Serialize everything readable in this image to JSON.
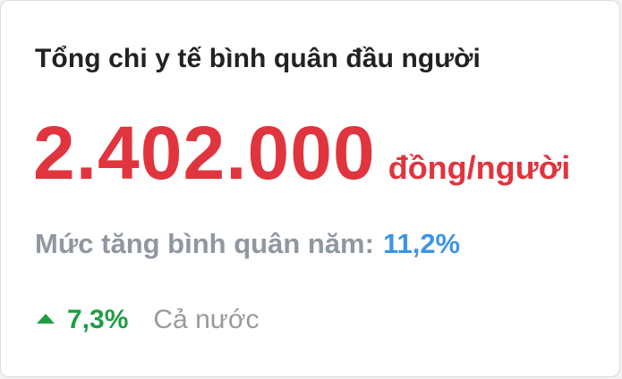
{
  "card": {
    "title": "Tổng chi y tế bình quân đầu người",
    "value": "2.402.000",
    "unit": "đồng/người",
    "growth_label": "Mức tăng bình quân năm:",
    "growth_value": "11,2%",
    "delta_value": "7,3%",
    "delta_scope": "Cả nước",
    "delta_icon": "triangle-up-icon"
  },
  "colors": {
    "value": "#e0353e",
    "growth_value": "#3d94e6",
    "delta": "#1f9d44",
    "title": "#222222",
    "muted": "#9097a0"
  }
}
